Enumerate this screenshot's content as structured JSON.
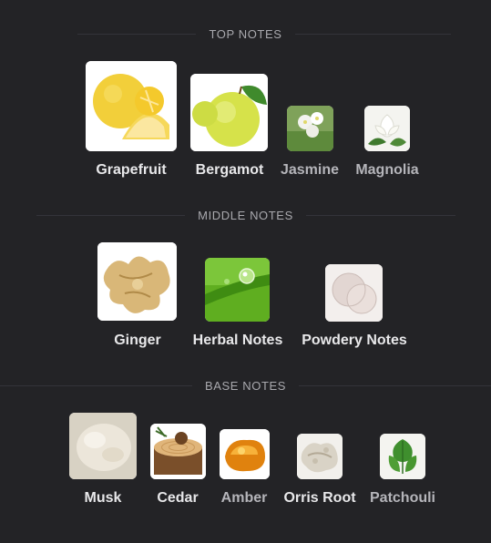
{
  "sections": {
    "top": {
      "title": "TOP NOTES",
      "notes": [
        {
          "label": "Grapefruit",
          "icon": "grapefruit-icon"
        },
        {
          "label": "Bergamot",
          "icon": "bergamot-icon"
        },
        {
          "label": "Jasmine",
          "icon": "jasmine-icon"
        },
        {
          "label": "Magnolia",
          "icon": "magnolia-icon"
        }
      ]
    },
    "middle": {
      "title": "MIDDLE NOTES",
      "notes": [
        {
          "label": "Ginger",
          "icon": "ginger-icon"
        },
        {
          "label": "Herbal Notes",
          "icon": "herbal-notes-icon"
        },
        {
          "label": "Powdery Notes",
          "icon": "powdery-notes-icon"
        }
      ]
    },
    "base": {
      "title": "BASE NOTES",
      "notes": [
        {
          "label": "Musk",
          "icon": "musk-icon"
        },
        {
          "label": "Cedar",
          "icon": "cedar-icon"
        },
        {
          "label": "Amber",
          "icon": "amber-icon"
        },
        {
          "label": "Orris Root",
          "icon": "orris-root-icon"
        },
        {
          "label": "Patchouli",
          "icon": "patchouli-icon"
        }
      ]
    }
  },
  "colors": {
    "background": "#232326",
    "divider": "#34343a",
    "header_text": "#a9a9ae",
    "label_primary": "#e8e8ea",
    "label_secondary": "#b5b5ba"
  }
}
